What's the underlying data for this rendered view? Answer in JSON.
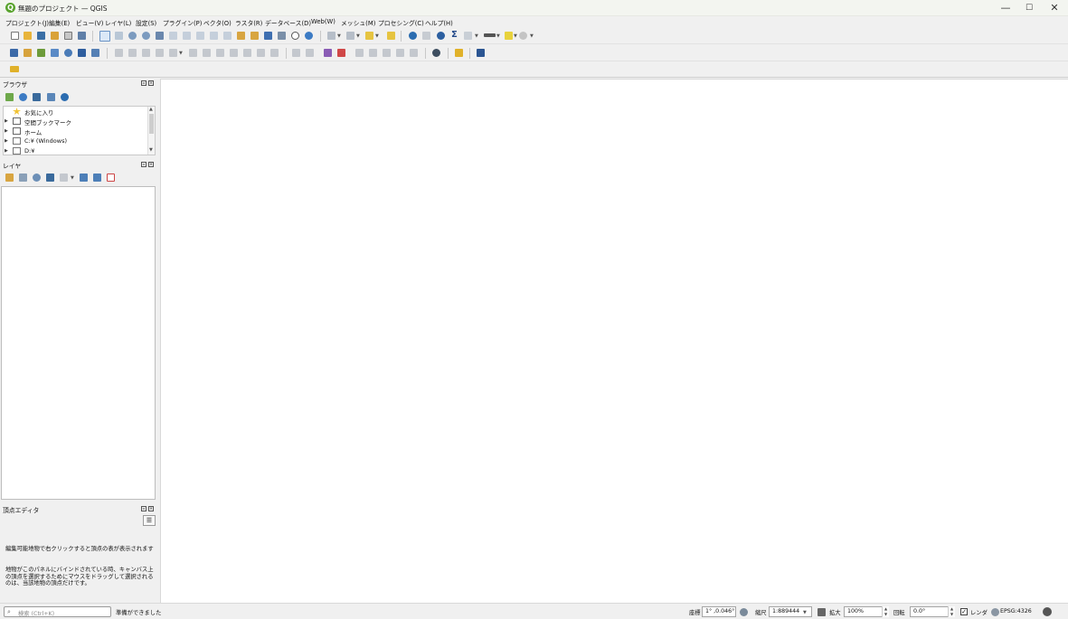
{
  "window": {
    "title": "無題のプロジェクト — QGIS"
  },
  "menu": [
    "プロジェクト(J)",
    "編集(E)",
    "ビュー(V)",
    "レイヤ(L)",
    "設定(S)",
    "プラグイン(P)",
    "ベクタ(O)",
    "ラスタ(R)",
    "データベース(D)",
    "Web(W)",
    "メッシュ(M)",
    "プロセシング(C)",
    "ヘルプ(H)"
  ],
  "browser": {
    "title": "ブラウザ",
    "items": [
      {
        "label": "お気に入り",
        "icon": "star-icon"
      },
      {
        "label": "空間ブックマーク",
        "icon": "bookmark-icon"
      },
      {
        "label": "ホーム",
        "icon": "home-icon"
      },
      {
        "label": "C:¥ (Windows)",
        "icon": "folder-icon"
      },
      {
        "label": "D:¥",
        "icon": "folder-icon"
      }
    ]
  },
  "layers": {
    "title": "レイヤ"
  },
  "vertex_editor": {
    "title": "頂点エディタ",
    "msg1": "編集可能地物で右クリックすると頂点の表が表示されます",
    "msg2": "地物がこのパネルにバインドされている時、キャンバス上の頂点を選択するためにマウスをドラッグして選択されるのは、当該地物の頂点だけです。"
  },
  "status": {
    "search_placeholder": "検索 (Ctrl+K)",
    "message": "準備ができました",
    "coord_label": "座標",
    "coord_value": "1° ,0.046°",
    "scale_label": "縮尺",
    "scale_value": "1:889444",
    "magnifier_label": "拡大",
    "magnifier_value": "100%",
    "rotation_label": "回転",
    "rotation_value": "0.0°",
    "render_label": "レンダ",
    "crs": "EPSG:4326"
  },
  "colors": {
    "qgis_green": "#58a32c",
    "accent_blue": "#2b6cb0",
    "accent_yellow": "#e0b12a"
  }
}
